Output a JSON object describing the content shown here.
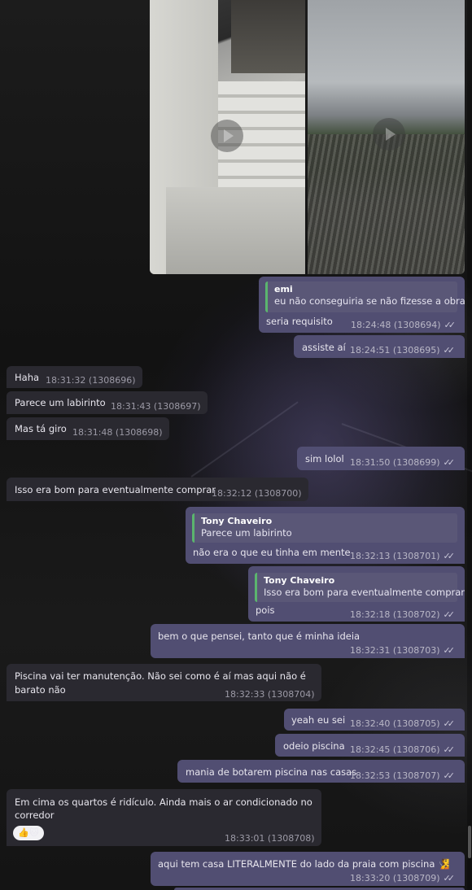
{
  "messages": [
    {
      "id": "m1",
      "dir": "out",
      "quote_name": "emi",
      "quote_text": "eu não conseguiria se não fizesse a obra",
      "text": "seria requisito",
      "time": "18:24:48",
      "num": "(1308694)"
    },
    {
      "id": "m2",
      "dir": "out",
      "text": "assiste aí",
      "time": "18:24:51",
      "num": "(1308695)"
    },
    {
      "id": "m3",
      "dir": "in",
      "text": "Haha",
      "time": "18:31:32",
      "num": "(1308696)"
    },
    {
      "id": "m4",
      "dir": "in",
      "text": "Parece um labirinto",
      "time": "18:31:43",
      "num": "(1308697)"
    },
    {
      "id": "m5",
      "dir": "in",
      "text": "Mas tá giro",
      "time": "18:31:48",
      "num": "(1308698)"
    },
    {
      "id": "m6",
      "dir": "out",
      "text": "sim lolol",
      "time": "18:31:50",
      "num": "(1308699)"
    },
    {
      "id": "m7",
      "dir": "in",
      "text": "Isso era bom para eventualmente comprar",
      "time": "18:32:12",
      "num": "(1308700)"
    },
    {
      "id": "m8",
      "dir": "out",
      "quote_name": "Tony Chaveiro",
      "quote_text": "Parece um labirinto",
      "text": "não era o que eu tinha em mente",
      "time": "18:32:13",
      "num": "(1308701)"
    },
    {
      "id": "m9",
      "dir": "out",
      "quote_name": "Tony Chaveiro",
      "quote_text": "Isso era bom para eventualmente comprar",
      "text": "pois",
      "time": "18:32:18",
      "num": "(1308702)"
    },
    {
      "id": "m10",
      "dir": "out",
      "text": "bem o que pensei, tanto que é minha ideia",
      "time": "18:32:31",
      "num": "(1308703)"
    },
    {
      "id": "m11",
      "dir": "in",
      "text_line1": "Piscina vai ter manutenção. Não sei como é aí mas aqui não é",
      "text_line2": "barato não",
      "time": "18:32:33",
      "num": "(1308704)"
    },
    {
      "id": "m12",
      "dir": "out",
      "text": "yeah eu sei",
      "time": "18:32:40",
      "num": "(1308705)"
    },
    {
      "id": "m13",
      "dir": "out",
      "text": "odeio piscina",
      "time": "18:32:45",
      "num": "(1308706)"
    },
    {
      "id": "m14",
      "dir": "out",
      "text": "mania de botarem piscina nas casas",
      "time": "18:32:53",
      "num": "(1308707)"
    },
    {
      "id": "m15",
      "dir": "in",
      "text_line1": "Em cima os quartos é ridículo. Ainda mais o ar condicionado no",
      "text_line2": "corredor",
      "reactions": "👍🐱",
      "time": "18:33:01",
      "num": "(1308708)"
    },
    {
      "id": "m16",
      "dir": "out",
      "text": "aqui tem casa LITERALMENTE do lado da praia com piscina 🧏",
      "time": "18:33:20",
      "num": "(1308709)"
    }
  ],
  "ticks": "✓✓",
  "colors": {
    "incoming": "#2a2930",
    "outgoing": "#514e72",
    "quote_bar": "#5bb56e"
  }
}
